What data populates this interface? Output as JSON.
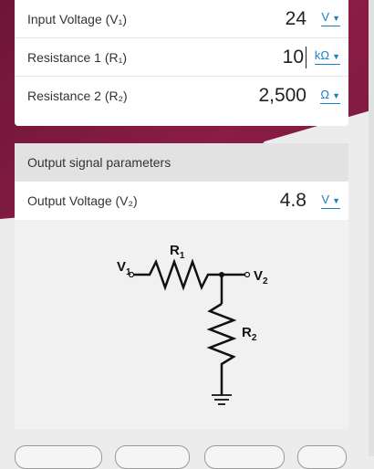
{
  "inputs": [
    {
      "label": "Input Voltage (V₁)",
      "value": "24",
      "unit": "V"
    },
    {
      "label": "Resistance 1 (R₁)",
      "value": "10",
      "unit": "kΩ"
    },
    {
      "label": "Resistance 2 (R₂)",
      "value": "2,500",
      "unit": "Ω"
    }
  ],
  "output": {
    "section_title": "Output signal parameters",
    "label": "Output Voltage (V₂)",
    "value": "4.8",
    "unit": "V"
  },
  "diagram": {
    "labels": {
      "v1": "V",
      "v1_sub": "1",
      "r1": "R",
      "r1_sub": "1",
      "v2": "V",
      "v2_sub": "2",
      "r2": "R",
      "r2_sub": "2"
    }
  },
  "icons": {
    "dropdown": "chevron-down-icon"
  },
  "colors": {
    "accent": "#1a7fc4",
    "brand": "#7a1a3e"
  }
}
